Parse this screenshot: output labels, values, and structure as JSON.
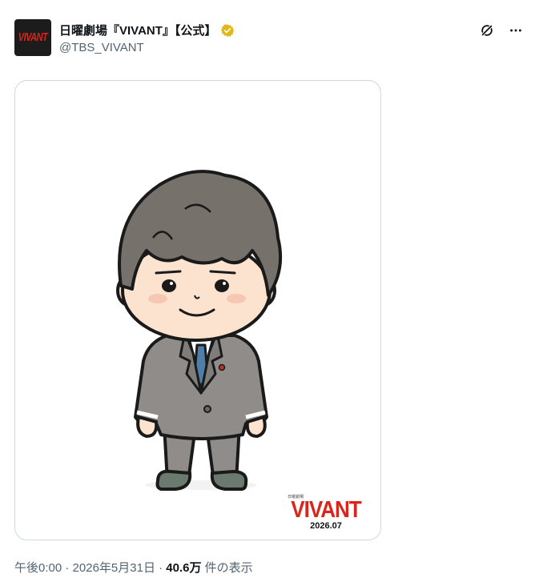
{
  "account": {
    "avatar_text": "VIVANT",
    "display_name": "日曜劇場『VIVANT』【公式】",
    "handle": "@TBS_VIVANT",
    "verified_color": "#e2b719"
  },
  "actions": {
    "grok_icon": "grok-icon",
    "more_icon": "more-icon"
  },
  "media": {
    "logo_small": "日曜劇場",
    "logo_title": "VIVANT",
    "logo_year": "2026.07"
  },
  "meta": {
    "time": "午後0:00",
    "sep1": " · ",
    "date": "2026年5月31日",
    "sep2": " · ",
    "views_count": "40.6万",
    "views_label": " 件の表示"
  },
  "colors": {
    "brand_red": "#d9251c",
    "text_secondary": "#536471",
    "border": "#cfd9de"
  }
}
